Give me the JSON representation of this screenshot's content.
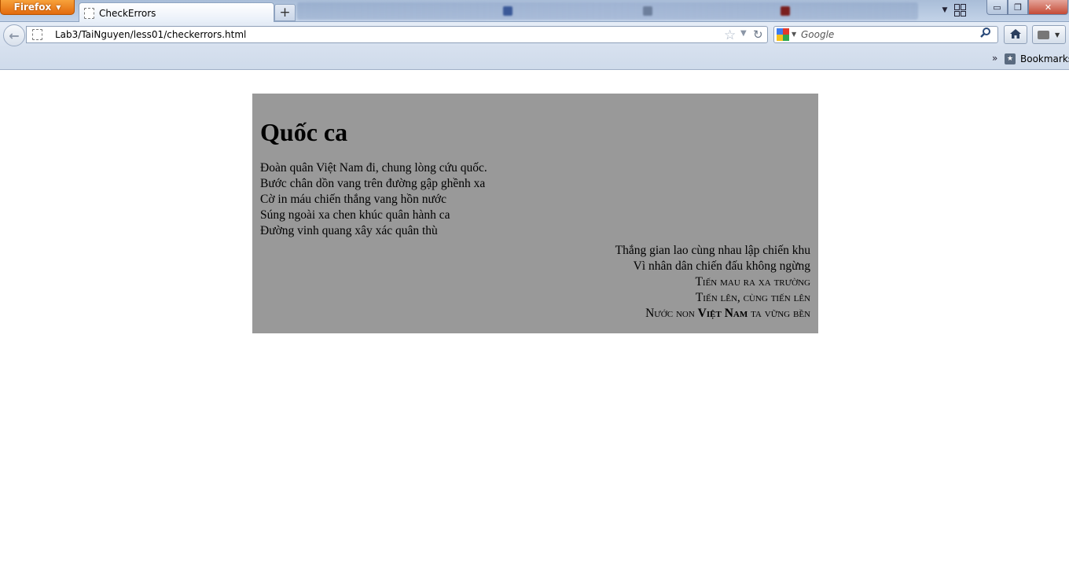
{
  "browser": {
    "app_menu_label": "Firefox",
    "active_tab_title": "CheckErrors",
    "new_tab_label": "+",
    "url": "Lab3/TaiNguyen/less01/checkerrors.html",
    "search_placeholder": "Google",
    "bookmarks_label": "Bookmarks",
    "window_controls": {
      "minimize": "▭",
      "maximize": "❐",
      "close": "✕"
    }
  },
  "icons": {
    "back": "arrow-left-icon",
    "star": "star-icon",
    "reload": "reload-icon",
    "search": "magnifier-icon",
    "home": "home-icon",
    "bookmarks": "bookmarks-star-icon"
  },
  "colors": {
    "firefox_button": "#e26a0d",
    "poem_background": "#999999",
    "toolbar": "#d6e0ee"
  },
  "poem": {
    "title": "Quốc ca",
    "verse_left": [
      "Đoàn quân Việt Nam đi, chung lòng cứu quốc.",
      "Bước chân dồn vang trên đường gập ghềnh xa",
      "Cờ in máu chiến thắng vang hồn nước",
      "Súng ngoài xa chen khúc quân hành ca",
      "Đường vinh quang xây xác quân thù"
    ],
    "verse_right": [
      "Thắng gian lao cùng nhau lập chiến khu",
      "Vì nhân dân chiến đấu không ngừng",
      "Tiến mau ra xa trường",
      "Tiến lên, cùng tiến lên"
    ],
    "last_line": {
      "part1": "Nước non ",
      "bold": "Việt Nam",
      "part2": " ta vững bền"
    }
  }
}
